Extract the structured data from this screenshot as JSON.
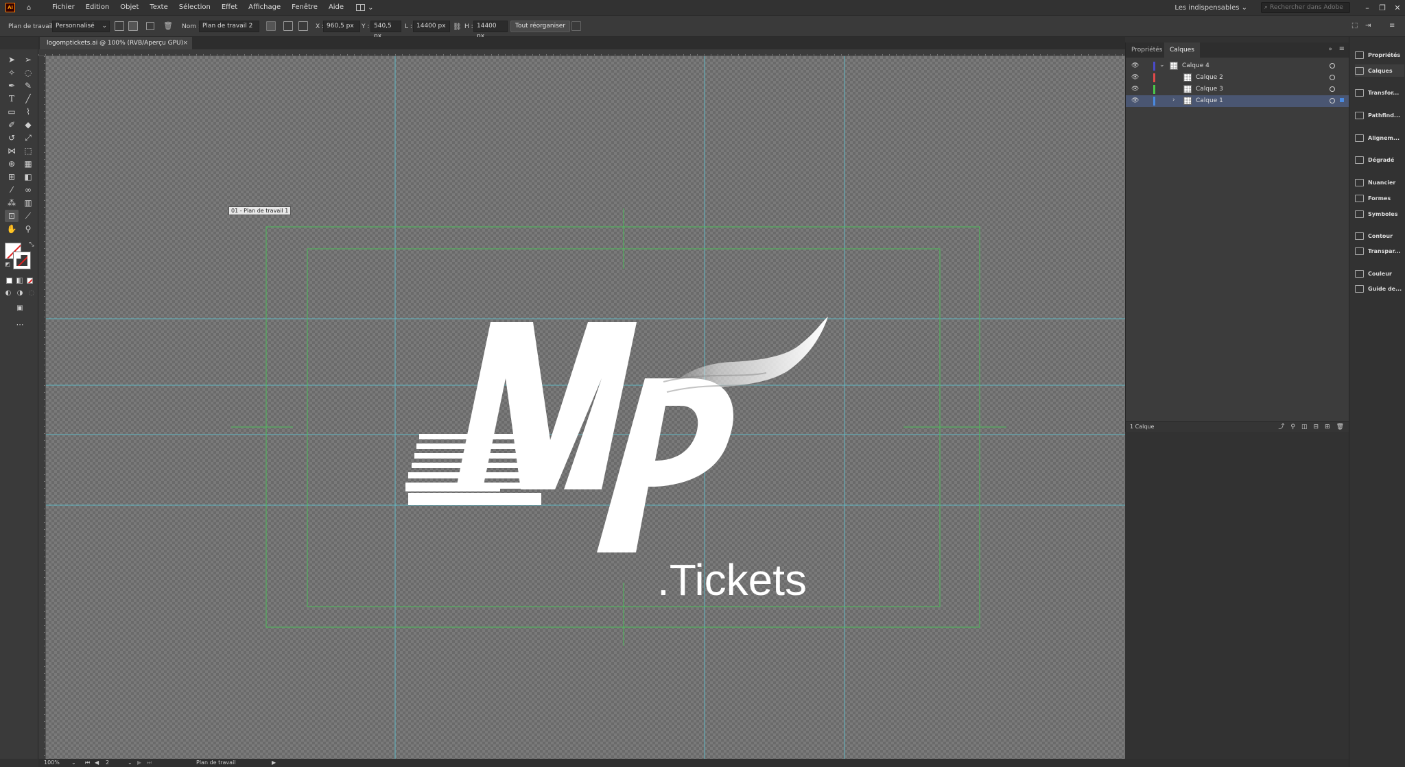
{
  "app": {
    "icon_text": "Ai"
  },
  "menu": [
    "Fichier",
    "Edition",
    "Objet",
    "Texte",
    "Sélection",
    "Effet",
    "Affichage",
    "Fenêtre",
    "Aide"
  ],
  "workspace": {
    "label": "Les indispensables",
    "search_placeholder": "Rechercher dans Adobe Stock"
  },
  "control_bar": {
    "mode_label": "Plan de travail",
    "preset": "Personnalisé",
    "name_label": "Nom :",
    "name_value": "Plan de travail 2",
    "x_label": "X :",
    "x_value": "960,5 px",
    "y_label": "Y :",
    "y_value": "540,5 px",
    "w_label": "L :",
    "w_value": "14400 px",
    "h_label": "H :",
    "h_value": "14400 px",
    "rearrange_button": "Tout réorganiser"
  },
  "document": {
    "tab_title": "logomptickets.ai @ 100% (RVB/Aperçu GPU)",
    "close": "×"
  },
  "artboard": {
    "label": "01 - Plan de travail 1"
  },
  "logo": {
    "mark": "Mp",
    "wordmark": ".Tickets",
    "fill": "#ffffff"
  },
  "layers_panel": {
    "tabs": [
      "Propriétés",
      "Calques"
    ],
    "active_tab": "Calques",
    "layers": [
      {
        "name": "Calque 4",
        "color": "#4a4ac8",
        "level": 0,
        "expanded": true
      },
      {
        "name": "Calque 2",
        "color": "#e04a4a",
        "level": 1
      },
      {
        "name": "Calque 3",
        "color": "#4ac84a",
        "level": 1
      },
      {
        "name": "Calque 1",
        "color": "#4a8ae0",
        "level": 1,
        "selected": true
      }
    ],
    "footer_count": "1 Calque"
  },
  "dock": [
    {
      "label": "Propriétés",
      "icon": "properties-icon"
    },
    {
      "label": "Calques",
      "icon": "layers-icon",
      "active": true
    },
    {
      "label": "Transfor...",
      "icon": "transform-icon"
    },
    {
      "label": "Pathfind...",
      "icon": "pathfinder-icon"
    },
    {
      "label": "Alignem...",
      "icon": "align-icon"
    },
    {
      "label": "Dégradé",
      "icon": "gradient-icon"
    },
    {
      "label": "Nuancier",
      "icon": "swatches-icon"
    },
    {
      "label": "Formes",
      "icon": "brushes-icon"
    },
    {
      "label": "Symboles",
      "icon": "symbols-icon"
    },
    {
      "label": "Contour",
      "icon": "stroke-icon"
    },
    {
      "label": "Transpar...",
      "icon": "transparency-icon"
    },
    {
      "label": "Couleur",
      "icon": "color-icon"
    },
    {
      "label": "Guide de...",
      "icon": "color-guide-icon"
    }
  ],
  "status": {
    "zoom": "100%",
    "artboard_index": "2",
    "tool_label": "Plan de travail"
  }
}
